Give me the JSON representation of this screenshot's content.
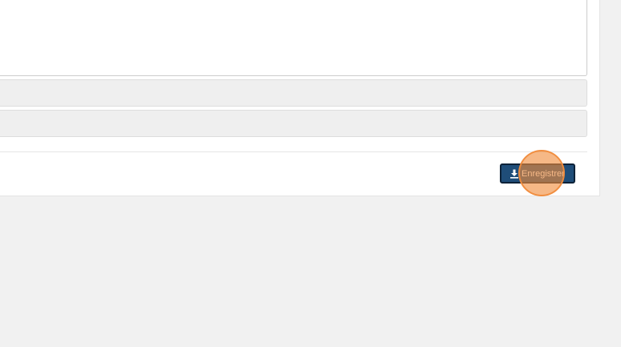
{
  "form": {
    "save_button": {
      "label": "Enregistrer",
      "icon": "download-icon"
    }
  },
  "colors": {
    "page_background": "#f1f1f1",
    "card_background": "#ffffff",
    "panel_background": "#efefef",
    "button_background": "#1f4d78",
    "click_marker": "#f08c3c"
  }
}
